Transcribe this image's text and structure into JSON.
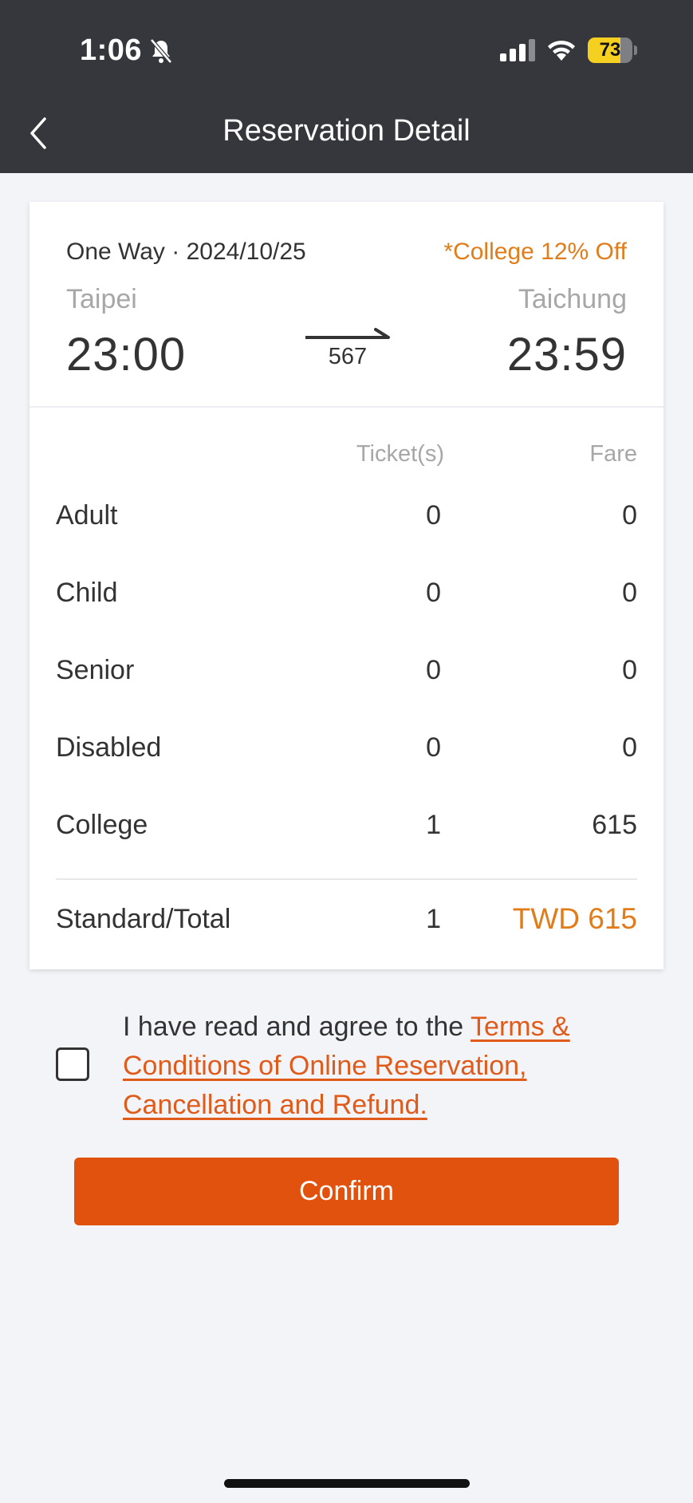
{
  "status_bar": {
    "time": "1:06",
    "battery": "73",
    "battery_level": 0.73,
    "icons": [
      "bell-slash-icon",
      "cellular-signal-icon",
      "wifi-icon",
      "battery-icon"
    ]
  },
  "header": {
    "title": "Reservation Detail",
    "back_icon": "chevron-left-icon"
  },
  "trip": {
    "meta": "One Way · 2024/10/25",
    "discount": "*College 12% Off",
    "from_station": "Taipei",
    "to_station": "Taichung",
    "depart_time": "23:00",
    "arrive_time": "23:59",
    "train_number": "567"
  },
  "fare_table": {
    "headers": {
      "tickets": "Ticket(s)",
      "fare": "Fare"
    },
    "rows": [
      {
        "label": "Adult",
        "tickets": "0",
        "fare": "0"
      },
      {
        "label": "Child",
        "tickets": "0",
        "fare": "0"
      },
      {
        "label": "Senior",
        "tickets": "0",
        "fare": "0"
      },
      {
        "label": "Disabled",
        "tickets": "0",
        "fare": "0"
      },
      {
        "label": "College",
        "tickets": "1",
        "fare": "615"
      }
    ],
    "total": {
      "label": "Standard/Total",
      "tickets": "1",
      "fare": "TWD 615"
    }
  },
  "agreement": {
    "text": "I have read and agree to the ",
    "link": "Terms & Conditions of Online Reservation, Cancellation and Refund.",
    "checked": false
  },
  "confirm_button": {
    "label": "Confirm"
  },
  "colors": {
    "header_bg": "#35373c",
    "accent_orange": "#e07d1a",
    "button_orange": "#e0520d",
    "link_orange": "#e05a19",
    "page_bg": "#f3f4f7"
  }
}
